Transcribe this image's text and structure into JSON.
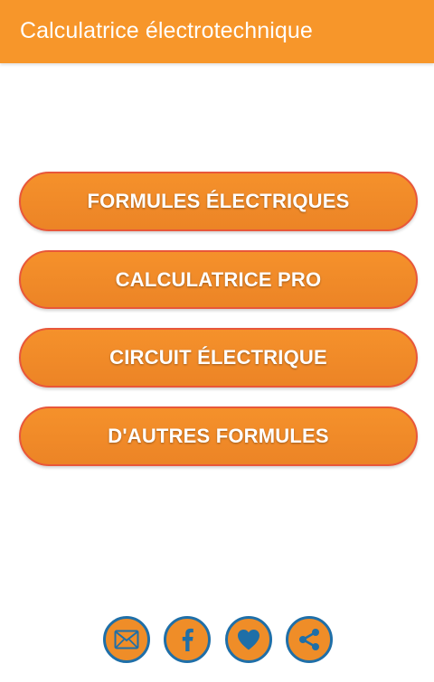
{
  "app_bar": {
    "title": "Calculatrice électrotechnique",
    "color": "#f7962a"
  },
  "menu": {
    "items": [
      {
        "label": "FORMULES ÉLECTRIQUES"
      },
      {
        "label": "CALCULATRICE PRO"
      },
      {
        "label": "CIRCUIT ÉLECTRIQUE"
      },
      {
        "label": "D'AUTRES FORMULES"
      }
    ],
    "button_color": "#ef8a28",
    "border_color": "#e8573a"
  },
  "social": {
    "icons": [
      "mail-icon",
      "facebook-icon",
      "heart-icon",
      "share-icon"
    ],
    "ring_color": "#1f6fa8"
  }
}
